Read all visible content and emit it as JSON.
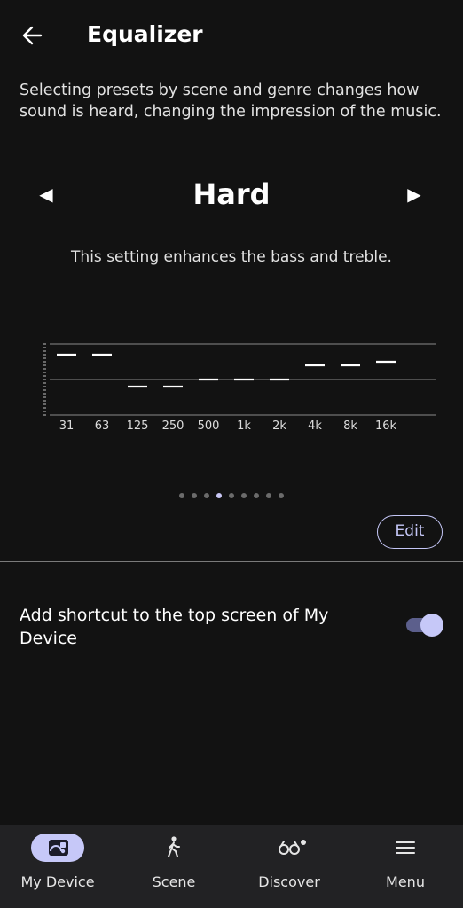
{
  "header": {
    "title": "Equalizer",
    "back_icon": "arrow-left-icon"
  },
  "description": "Selecting presets by scene and genre changes how sound is heard, changing the impression of the music.",
  "preset": {
    "name": "Hard",
    "description": "This setting enhances the bass and treble.",
    "prev_icon": "triangle-left-icon",
    "next_icon": "triangle-right-icon",
    "prev_symbol": "◀",
    "next_symbol": "▶"
  },
  "equalizer": {
    "bands": [
      "31",
      "63",
      "125",
      "250",
      "500",
      "1k",
      "2k",
      "4k",
      "8k",
      "16k"
    ],
    "levels": [
      7,
      7,
      -2,
      -2,
      0,
      0,
      0,
      4,
      4,
      5
    ],
    "range": [
      -10,
      10
    ]
  },
  "pagination": {
    "count": 9,
    "active_index": 3
  },
  "edit_label": "Edit",
  "shortcut": {
    "label": "Add shortcut to the top screen of My Device",
    "enabled": true
  },
  "nav": {
    "items": [
      {
        "label": "My Device",
        "icon": "speaker-device-icon",
        "active": true
      },
      {
        "label": "Scene",
        "icon": "walking-person-icon",
        "active": false
      },
      {
        "label": "Discover",
        "icon": "binoculars-icon",
        "active": false,
        "badge": true
      },
      {
        "label": "Menu",
        "icon": "hamburger-menu-icon",
        "active": false
      }
    ]
  },
  "colors": {
    "background": "#121212",
    "accent": "#c6c8f8",
    "nav_background": "#222224"
  }
}
